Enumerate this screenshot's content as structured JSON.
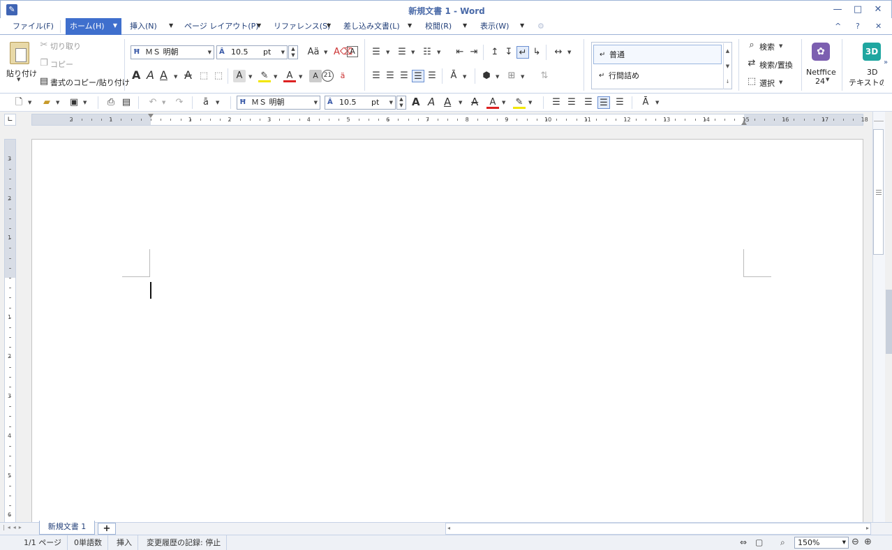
{
  "window": {
    "title": "新規文書 1 - Word",
    "min": "—",
    "max": "□",
    "close": "✕"
  },
  "menubar": {
    "items": [
      {
        "label": "ファイル(F)"
      },
      {
        "label": "ホーム(H)"
      },
      {
        "label": "挿入(N)"
      },
      {
        "label": "ページ レイアウト(P)"
      },
      {
        "label": "リファレンス(S)"
      },
      {
        "label": "差し込み文書(L)"
      },
      {
        "label": "校閲(R)"
      },
      {
        "label": "表示(W)"
      }
    ],
    "mini": {
      "collapse": "^",
      "help": "?",
      "close": "✕"
    }
  },
  "ribbon": {
    "clipboard": {
      "paste": "貼り付け",
      "cut": "切り取り",
      "copy": "コピー",
      "format_painter": "書式のコピー/貼り付け"
    },
    "font": {
      "name": "ＭＳ 明朝",
      "size": "10.5",
      "unit": "pt"
    },
    "styles": {
      "items": [
        "普通",
        "行間詰め"
      ]
    },
    "editing": {
      "find": "検索",
      "replace": "検索/置換",
      "select": "選択"
    },
    "netffice": {
      "label": "Netffice",
      "sub": "24"
    },
    "text3d": {
      "label": "3D",
      "sub": "テキストの"
    }
  },
  "toolbar": {
    "font": {
      "name": "ＭＳ 明朝",
      "size": "10.5",
      "unit": "pt"
    }
  },
  "hruler": {
    "labels": [
      "2",
      "1",
      "1",
      "2",
      "3",
      "4",
      "5",
      "6",
      "7",
      "8",
      "9",
      "10",
      "11",
      "12",
      "13",
      "14",
      "15",
      "16",
      "17",
      "18"
    ]
  },
  "vruler": {
    "labels": [
      "3",
      "2",
      "1",
      "1",
      "2",
      "3",
      "4",
      "5",
      "6"
    ]
  },
  "tabs": {
    "doc": "新規文書 1",
    "add": "+"
  },
  "status": {
    "page": "1/1 ページ",
    "words": "0単語数",
    "mode": "挿入",
    "track": "変更履歴の記録: 停止",
    "zoom": "150%"
  }
}
